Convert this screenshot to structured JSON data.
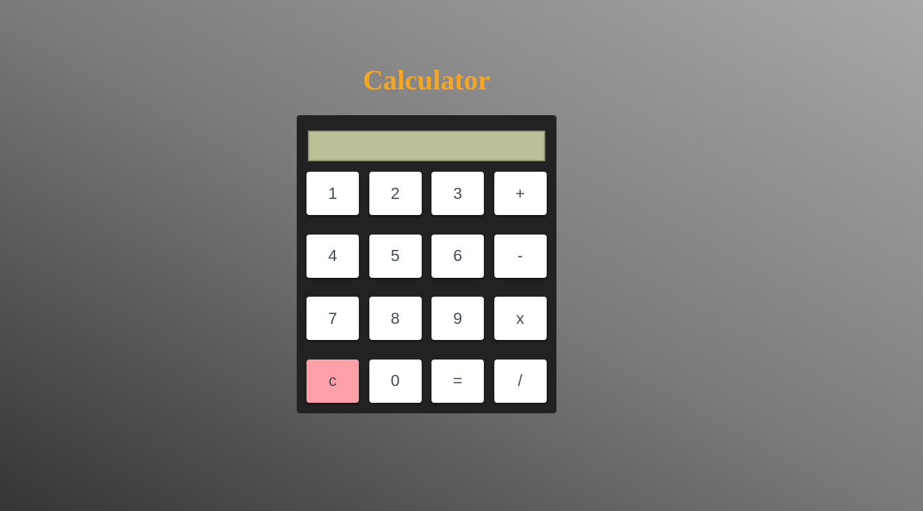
{
  "title": "Calculator",
  "display": {
    "value": ""
  },
  "keys": [
    {
      "label": "1",
      "name": "key-1"
    },
    {
      "label": "2",
      "name": "key-2"
    },
    {
      "label": "3",
      "name": "key-3"
    },
    {
      "label": "+",
      "name": "add-button"
    },
    {
      "label": "4",
      "name": "key-4"
    },
    {
      "label": "5",
      "name": "key-5"
    },
    {
      "label": "6",
      "name": "key-6"
    },
    {
      "label": "-",
      "name": "subtract-button"
    },
    {
      "label": "7",
      "name": "key-7"
    },
    {
      "label": "8",
      "name": "key-8"
    },
    {
      "label": "9",
      "name": "key-9"
    },
    {
      "label": "x",
      "name": "multiply-button"
    },
    {
      "label": "c",
      "name": "clear-button"
    },
    {
      "label": "0",
      "name": "key-0"
    },
    {
      "label": "=",
      "name": "equals-button"
    },
    {
      "label": "/",
      "name": "divide-button"
    }
  ],
  "colors": {
    "title": "#f5a623",
    "display_background": "#bcbf98",
    "clear_key": "#ff9fa8",
    "body": "#222222"
  }
}
